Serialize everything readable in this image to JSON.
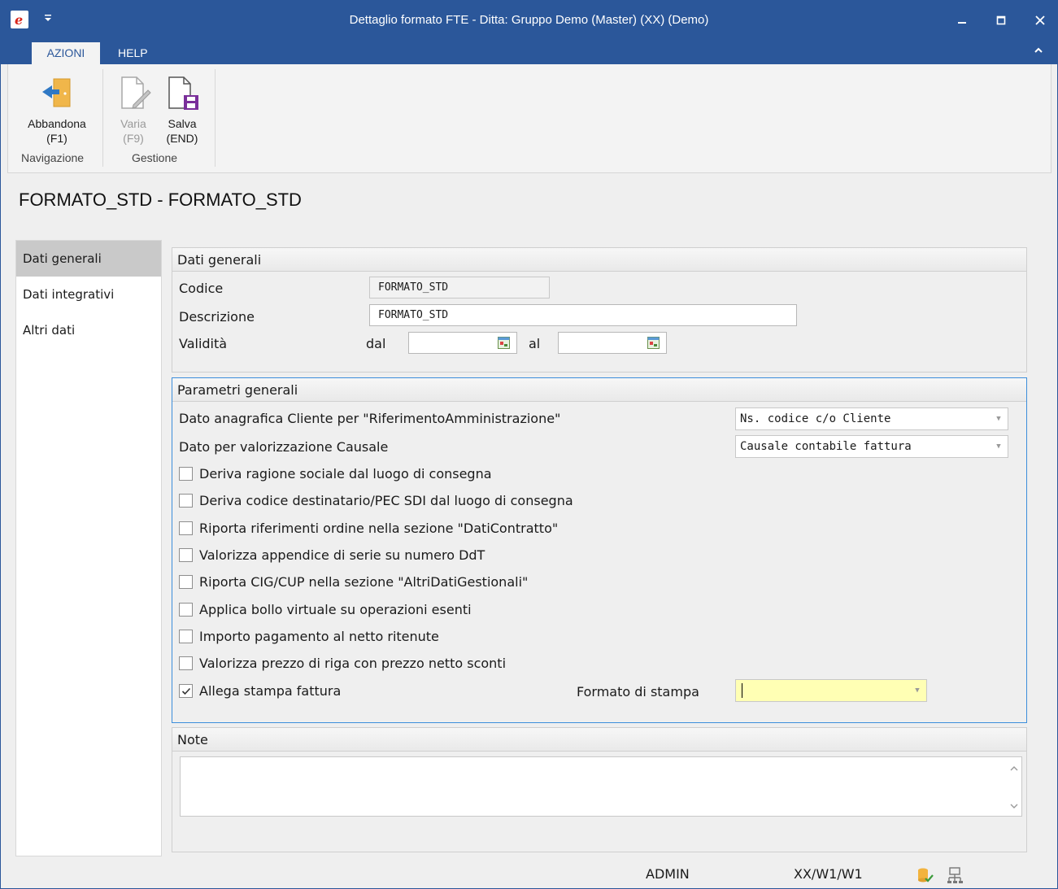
{
  "window": {
    "title": "Dettaglio formato FTE - Ditta: Gruppo Demo (Master) (XX)  (Demo)"
  },
  "tabs": [
    {
      "label": "AZIONI"
    },
    {
      "label": "HELP"
    }
  ],
  "ribbon": {
    "abbandona": {
      "label": "Abbandona",
      "key": "(F1)"
    },
    "varia": {
      "label": "Varia",
      "key": "(F9)"
    },
    "salva": {
      "label": "Salva",
      "key": "(END)"
    },
    "groups": {
      "navigazione": "Navigazione",
      "gestione": "Gestione"
    }
  },
  "page": {
    "title": "FORMATO_STD - FORMATO_STD"
  },
  "nav": [
    {
      "label": "Dati generali"
    },
    {
      "label": "Dati integrativi"
    },
    {
      "label": "Altri dati"
    }
  ],
  "dati_generali": {
    "header": "Dati generali",
    "codice_label": "Codice",
    "codice_value": "FORMATO_STD",
    "descrizione_label": "Descrizione",
    "descrizione_value": "FORMATO_STD",
    "validita_label": "Validità",
    "dal_label": "dal",
    "al_label": "al",
    "dal_value": "",
    "al_value": ""
  },
  "parametri": {
    "header": "Parametri generali",
    "riferimento_label": "Dato anagrafica Cliente per \"RiferimentoAmministrazione\"",
    "riferimento_value": "Ns. codice c/o Cliente",
    "causale_label": "Dato per valorizzazione Causale",
    "causale_value": "Causale contabile fattura",
    "checks": [
      {
        "label": "Deriva ragione sociale dal luogo di consegna",
        "checked": false
      },
      {
        "label": "Deriva codice destinatario/PEC SDI dal luogo di consegna",
        "checked": false
      },
      {
        "label": "Riporta riferimenti ordine nella sezione \"DatiContratto\"",
        "checked": false
      },
      {
        "label": "Valorizza appendice di serie su numero DdT",
        "checked": false
      },
      {
        "label": "Riporta CIG/CUP nella sezione \"AltriDatiGestionali\"",
        "checked": false
      },
      {
        "label": "Applica bollo virtuale su operazioni esenti",
        "checked": false
      },
      {
        "label": "Importo pagamento al netto ritenute",
        "checked": false
      },
      {
        "label": "Valorizza prezzo di riga con prezzo netto sconti",
        "checked": false
      },
      {
        "label": "Allega stampa fattura",
        "checked": true
      }
    ],
    "formato_stampa_label": "Formato di stampa",
    "formato_stampa_value": ""
  },
  "note": {
    "header": "Note",
    "value": ""
  },
  "status": {
    "user": "ADMIN",
    "path": "XX/W1/W1"
  }
}
